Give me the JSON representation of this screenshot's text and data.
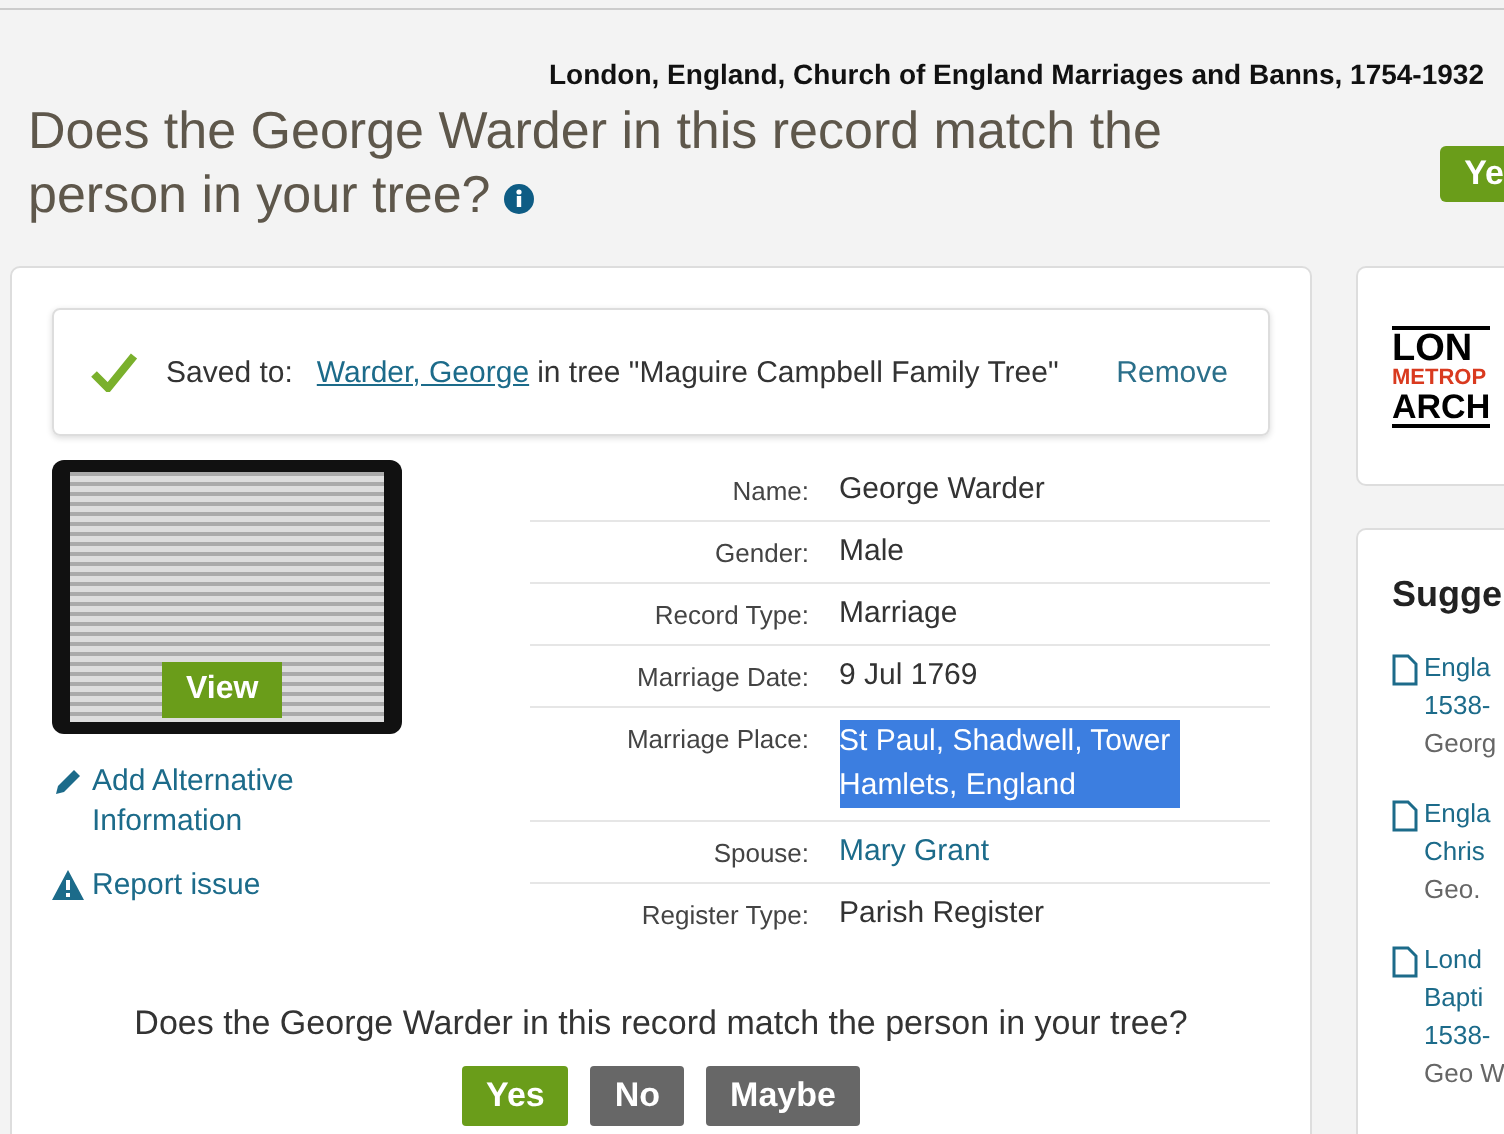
{
  "header": {
    "collection": "London, England, Church of England Marriages and Banns, 1754-1932",
    "question": "Does the George Warder in this record match the person in your tree?",
    "yes_button": "Ye"
  },
  "saved": {
    "label": "Saved to:",
    "person_link": "Warder, George",
    "tree_text": "in tree \"Maguire Campbell Family Tree\"",
    "remove": "Remove"
  },
  "image": {
    "view_button": "View"
  },
  "actions": [
    {
      "kind": "edit",
      "label": "Add Alternative Information"
    },
    {
      "kind": "warning",
      "label": "Report issue"
    }
  ],
  "details": [
    {
      "label": "Name:",
      "value": "George Warder",
      "link": false,
      "selected": false
    },
    {
      "label": "Gender:",
      "value": "Male",
      "link": false,
      "selected": false
    },
    {
      "label": "Record Type:",
      "value": "Marriage",
      "link": false,
      "selected": false
    },
    {
      "label": "Marriage Date:",
      "value": "9 Jul 1769",
      "link": false,
      "selected": false
    },
    {
      "label": "Marriage Place:",
      "value": "St Paul, Shadwell, Tower Hamlets, England",
      "link": false,
      "selected": true
    },
    {
      "label": "Spouse:",
      "value": "Mary Grant",
      "link": true,
      "selected": false
    },
    {
      "label": "Register Type:",
      "value": "Parish Register",
      "link": false,
      "selected": false
    }
  ],
  "match": {
    "question": "Does the George Warder in this record match the person in your tree?",
    "buttons": [
      {
        "label": "Yes",
        "kind": "primary"
      },
      {
        "label": "No",
        "kind": "secondary"
      },
      {
        "label": "Maybe",
        "kind": "secondary"
      }
    ]
  },
  "side": {
    "logo": [
      "LON",
      "METROP",
      "ARCH"
    ],
    "suggested_title": "Sugge",
    "suggestions": [
      {
        "lines": [
          "Engla",
          "1538-",
          "Georg"
        ]
      },
      {
        "lines": [
          "Engla",
          "Chris",
          "Geo."
        ]
      },
      {
        "lines": [
          "Lond",
          "Bapti",
          "1538-",
          "Geo W"
        ]
      }
    ]
  }
}
